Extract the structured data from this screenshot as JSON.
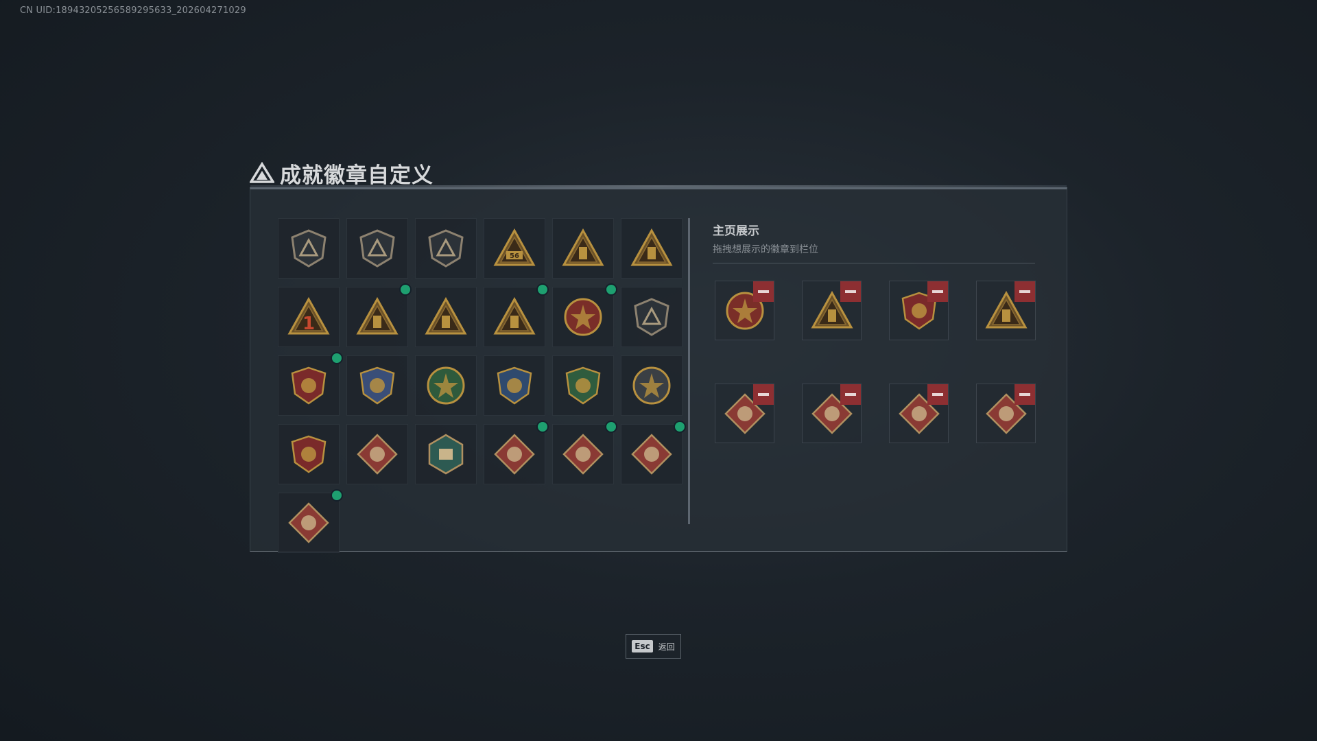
{
  "uid_text": "CN UID:18943205256589295633_202604271029",
  "title": "成就徽章自定义",
  "right_panel": {
    "title": "主页展示",
    "subtitle": "拖拽想展示的徽章到栏位"
  },
  "esc": {
    "key": "Esc",
    "label": "返回"
  },
  "colors": {
    "gold": "#b8913f",
    "dark_gold": "#6c5228",
    "red_badge": "#8a3a34",
    "green_dot": "#1ea070",
    "remove_red": "#8d2f32"
  },
  "badges": [
    {
      "icon": "triangle-shield-badge-icon",
      "new": false
    },
    {
      "icon": "helicopter-shield-badge-icon",
      "new": false
    },
    {
      "icon": "dagger-shield-badge-icon",
      "new": false
    },
    {
      "icon": "56-triangle-badge-icon",
      "new": false
    },
    {
      "icon": "tower-triangle-badge-icon",
      "new": false
    },
    {
      "icon": "bird-triangle-badge-icon",
      "new": false
    },
    {
      "icon": "number-1-triangle-badge-icon",
      "new": false
    },
    {
      "icon": "crate-triangle-badge-icon",
      "new": true
    },
    {
      "icon": "squad-triangle-badge-icon",
      "new": false
    },
    {
      "icon": "rocket-triangle-badge-icon",
      "new": true
    },
    {
      "icon": "star-skull-round-badge-icon",
      "new": true
    },
    {
      "icon": "wing-shield-badge-icon",
      "new": false
    },
    {
      "icon": "stars-crest-badge-icon",
      "new": true
    },
    {
      "icon": "tiger-crest-badge-icon",
      "new": false
    },
    {
      "icon": "beast-round-badge-icon",
      "new": false
    },
    {
      "icon": "rifle-crest-blue-badge-icon",
      "new": false
    },
    {
      "icon": "rifle-crest-green-badge-icon",
      "new": false
    },
    {
      "icon": "rifle-round-badge-icon",
      "new": false
    },
    {
      "icon": "crossed-rifles-crest-badge-icon",
      "new": false
    },
    {
      "icon": "wolf-diamond-badge-icon",
      "new": false
    },
    {
      "icon": "gear-hex-badge-icon",
      "new": false
    },
    {
      "icon": "dragon-diamond-badge-icon",
      "new": true
    },
    {
      "icon": "dragon-diamond-badge-icon",
      "new": true
    },
    {
      "icon": "runner-diamond-badge-icon",
      "new": true
    },
    {
      "icon": "scroll-diamond-badge-icon",
      "new": true
    }
  ],
  "showcase_slots": [
    {
      "icon": "star-skull-round-badge-icon"
    },
    {
      "icon": "crate-triangle-badge-icon"
    },
    {
      "icon": "stars-crest-badge-icon"
    },
    {
      "icon": "rocket-triangle-badge-icon"
    },
    {
      "icon": "runner-diamond-badge-icon"
    },
    {
      "icon": "dragon-diamond-badge-icon"
    },
    {
      "icon": "dragon-diamond-badge-icon"
    },
    {
      "icon": "scroll-diamond-badge-icon"
    }
  ]
}
